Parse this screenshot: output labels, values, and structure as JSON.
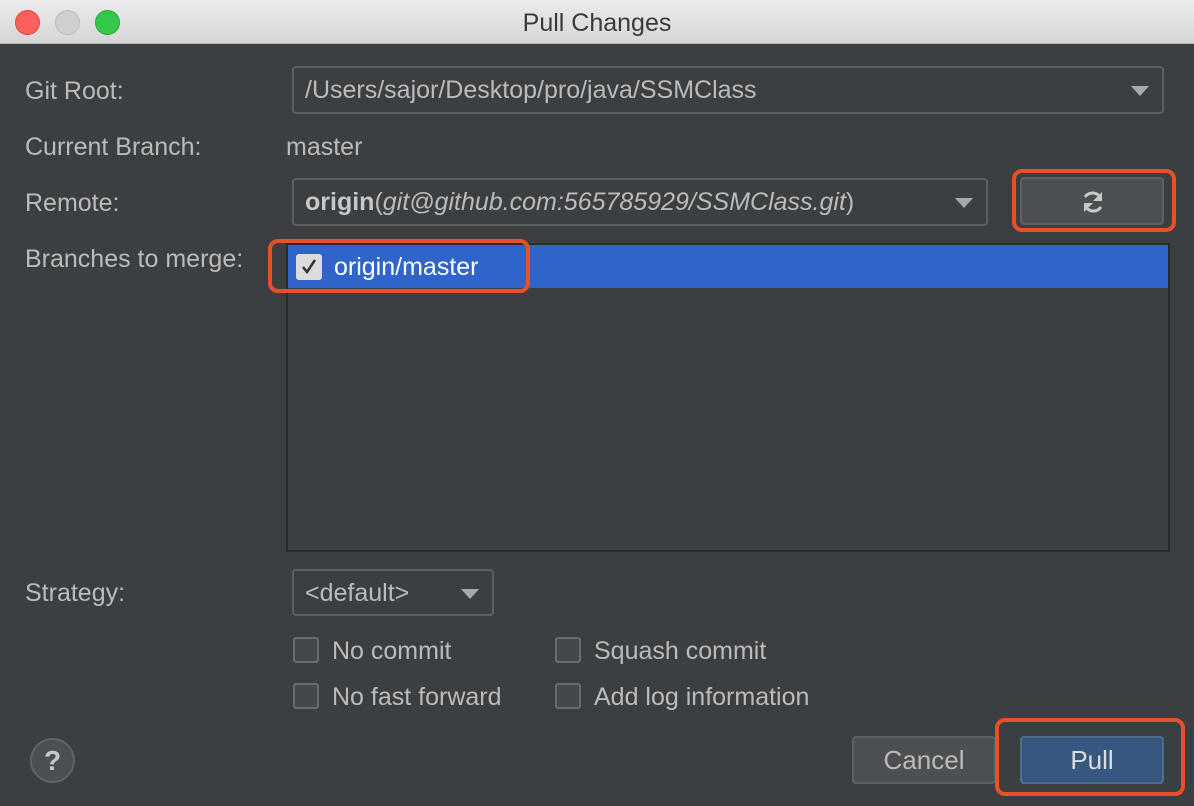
{
  "window": {
    "title": "Pull Changes"
  },
  "git_root": {
    "label": "Git Root:",
    "value": "/Users/sajor/Desktop/pro/java/SSMClass"
  },
  "current_branch": {
    "label": "Current Branch:",
    "value": "master"
  },
  "remote": {
    "label": "Remote:",
    "name": "origin",
    "url": "git@github.com:565785929/SSMClass.git",
    "open_paren": "(",
    "close_paren": ")"
  },
  "branches": {
    "label": "Branches to merge:",
    "items": [
      {
        "label": "origin/master",
        "checked": true
      }
    ]
  },
  "strategy": {
    "label": "Strategy:",
    "value": "<default>"
  },
  "options": {
    "no_commit": {
      "label": "No commit",
      "checked": false
    },
    "squash_commit": {
      "label": "Squash commit",
      "checked": false
    },
    "no_fast_forward": {
      "label": "No fast forward",
      "checked": false
    },
    "add_log_information": {
      "label": "Add log information",
      "checked": false
    }
  },
  "buttons": {
    "help": "?",
    "cancel": "Cancel",
    "pull": "Pull"
  },
  "colors": {
    "highlight": "#e8502a",
    "selection": "#2f65ca",
    "pull_button": "#365880"
  }
}
